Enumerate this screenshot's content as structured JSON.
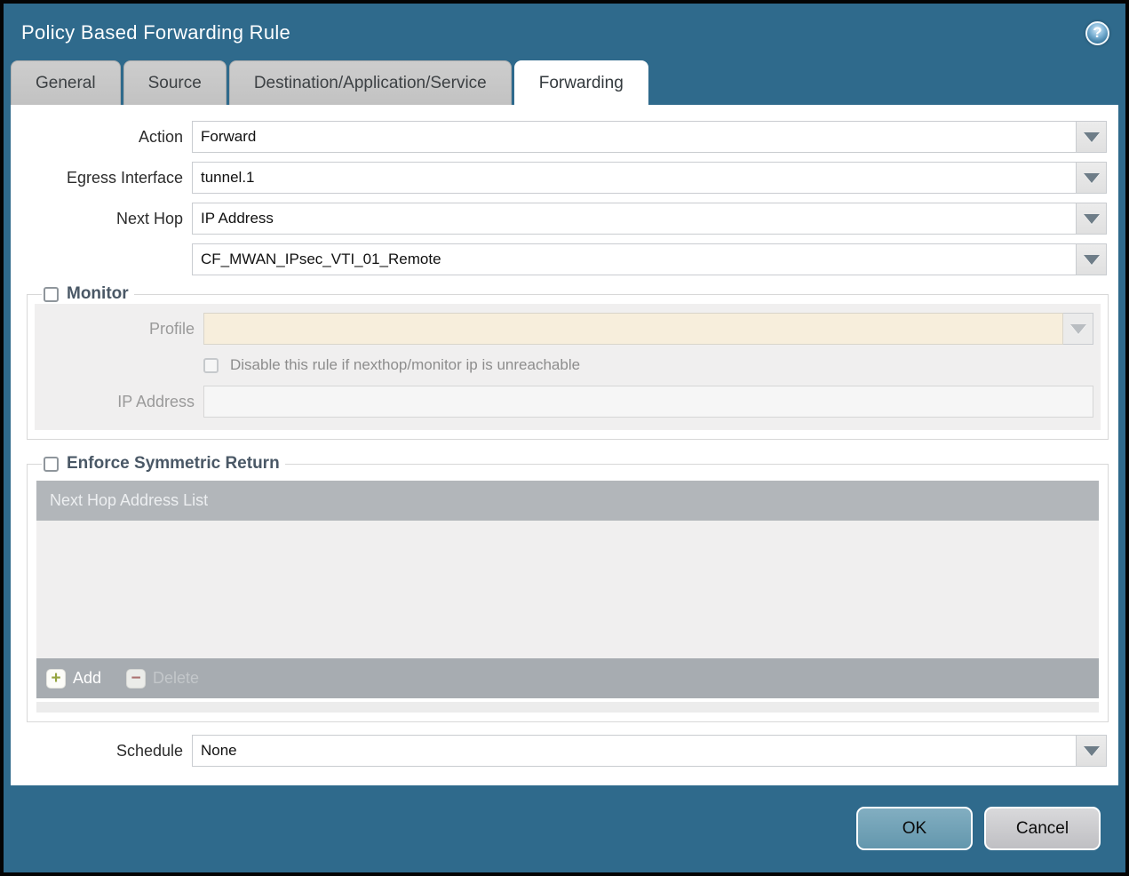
{
  "dialog": {
    "title": "Policy Based Forwarding Rule"
  },
  "help_icon": {
    "glyph": "?"
  },
  "tabs": [
    {
      "label": "General",
      "active": false
    },
    {
      "label": "Source",
      "active": false
    },
    {
      "label": "Destination/Application/Service",
      "active": false
    },
    {
      "label": "Forwarding",
      "active": true
    }
  ],
  "form": {
    "action": {
      "label": "Action",
      "value": "Forward"
    },
    "egress_interface": {
      "label": "Egress Interface",
      "value": "tunnel.1"
    },
    "next_hop": {
      "label": "Next Hop",
      "value": "IP Address"
    },
    "next_hop_address": {
      "value": "CF_MWAN_IPsec_VTI_01_Remote"
    },
    "schedule": {
      "label": "Schedule",
      "value": "None"
    }
  },
  "monitor": {
    "title": "Monitor",
    "checked": false,
    "profile": {
      "label": "Profile",
      "value": ""
    },
    "disable_rule": {
      "label": "Disable this rule if nexthop/monitor ip is unreachable",
      "checked": false
    },
    "ip_address": {
      "label": "IP Address",
      "value": ""
    }
  },
  "symmetric_return": {
    "title": "Enforce Symmetric Return",
    "checked": false,
    "table_header": "Next Hop Address List",
    "rows": [],
    "add_label": "Add",
    "add_glyph": "+",
    "delete_label": "Delete",
    "delete_glyph": "−"
  },
  "footer": {
    "ok_label": "OK",
    "cancel_label": "Cancel"
  },
  "colors": {
    "frame_teal": "#2F6A8C",
    "ok_button": "#6FA4B8",
    "cancel_button": "#C9C9CD",
    "tab_inactive": "#C6C6C6",
    "legend_text": "#4A5866",
    "table_header_bg": "#B2B6BA",
    "table_footer_bg": "#A7ACB1",
    "disabled_field_cream": "#F7EEDC",
    "panel_gray": "#F0EFEF",
    "add_plus_green": "#94A43E",
    "delete_minus_red": "#AC6361"
  }
}
